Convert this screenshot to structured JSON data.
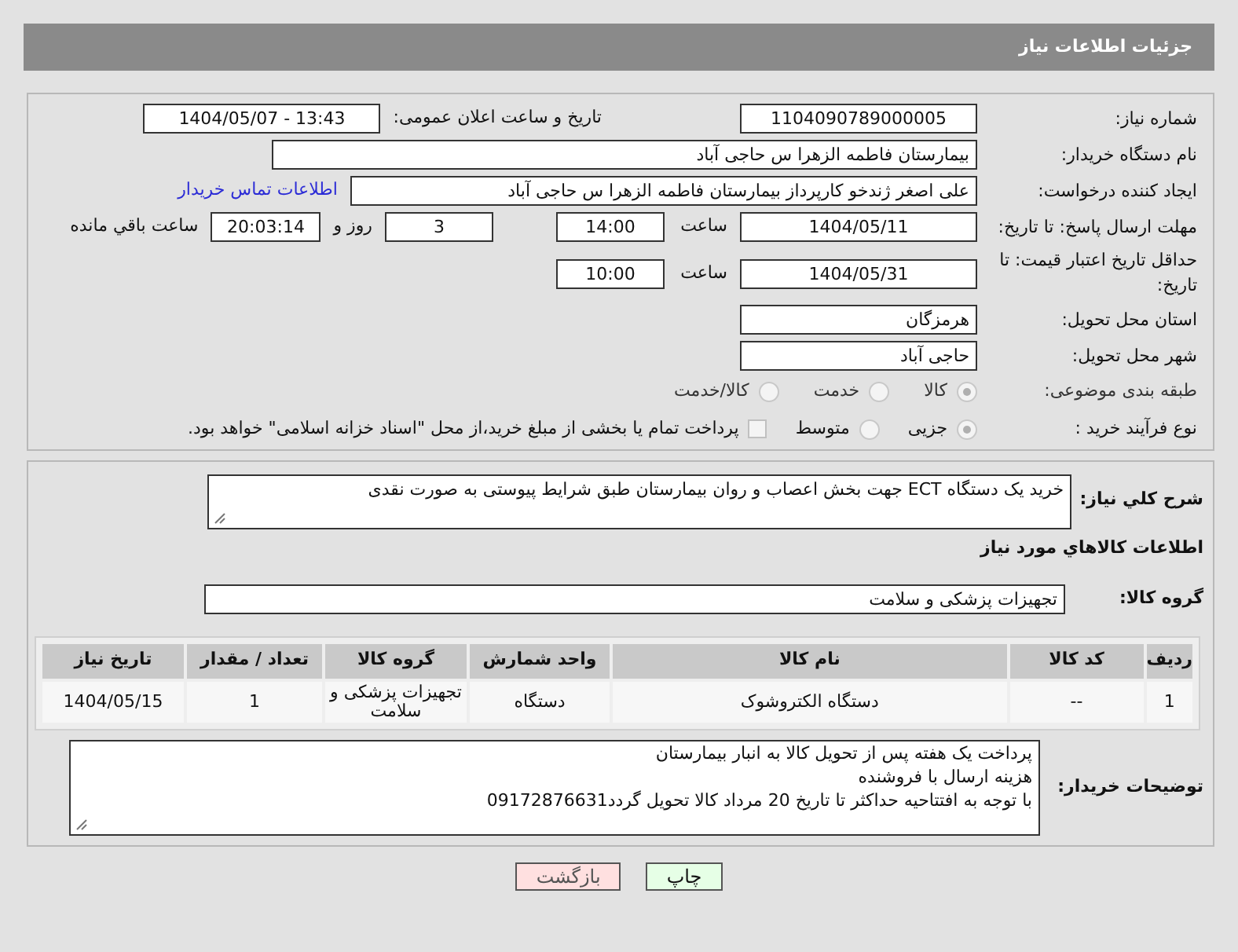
{
  "header": {
    "title": "جزئیات اطلاعات نیاز"
  },
  "need_number": {
    "label": "شماره نیاز:",
    "value": "1104090789000005"
  },
  "announce": {
    "label": "تاریخ و ساعت اعلان عمومی:",
    "value": "1404/05/07 - 13:43"
  },
  "buyer_org": {
    "label": "نام دستگاه خریدار:",
    "value": "بیمارستان فاطمه الزهرا  س  حاجی آباد"
  },
  "creator": {
    "label": "ایجاد کننده درخواست:",
    "value": "علی اصغر ژندخو کارپرداز بیمارستان فاطمه الزهرا  س  حاجی آباد",
    "link": "اطلاعات تماس خریدار"
  },
  "deadline": {
    "label": "مهلت ارسال پاسخ: تا تاریخ:",
    "date": "1404/05/11",
    "time_label": "ساعت",
    "time": "14:00",
    "days": "3",
    "days_label": "روز و",
    "remaining": "20:03:14",
    "remaining_label": "ساعت باقي مانده"
  },
  "validity": {
    "label": "حداقل تاریخ اعتبار قیمت: تا تاریخ:",
    "date": "1404/05/31",
    "time_label": "ساعت",
    "time": "10:00"
  },
  "province": {
    "label": "استان محل تحویل:",
    "value": "هرمزگان"
  },
  "city": {
    "label": "شهر محل تحویل:",
    "value": "حاجی آباد"
  },
  "category": {
    "label": "طبقه بندی موضوعی:",
    "options": [
      {
        "label": "کالا",
        "selected": true
      },
      {
        "label": "خدمت",
        "selected": false
      },
      {
        "label": "کالا/خدمت",
        "selected": false
      }
    ]
  },
  "process": {
    "label": "نوع فرآیند خرید :",
    "options": [
      {
        "label": "جزیی",
        "selected": true
      },
      {
        "label": "متوسط",
        "selected": false
      }
    ],
    "treasury": {
      "label": "پرداخت تمام یا بخشی از مبلغ خرید،از محل \"اسناد خزانه اسلامی\" خواهد بود.",
      "checked": false
    }
  },
  "description": {
    "label": "شرح کلي نياز:",
    "value": "خرید یک دستگاه ECT جهت بخش اعصاب و روان بیمارستان  طبق شرایط پیوستی به صورت نقدی"
  },
  "goods_title": "اطلاعات کالاهاي مورد نياز",
  "goods_group": {
    "label": "گروه کالا:",
    "value": "تجهیزات پزشکی و سلامت"
  },
  "table": {
    "columns": [
      "ردیف",
      "کد کالا",
      "نام کالا",
      "واحد شمارش",
      "گروه کالا",
      "تعداد / مقدار",
      "تاریخ نیاز"
    ],
    "rows": [
      [
        "1",
        "--",
        "دستگاه الکتروشوک",
        "دستگاه",
        "تجهیزات پزشکی و سلامت",
        "1",
        "1404/05/15"
      ]
    ]
  },
  "buyer_notes": {
    "label": "توضیحات خریدار:",
    "lines": [
      "پرداخت یک هفته پس از تحویل کالا به انبار بیمارستان",
      "هزینه ارسال با فروشنده",
      "با توجه به افتتاحیه حداکثر تا تاریخ 20 مرداد کالا تحویل گردد09172876631"
    ]
  },
  "buttons": [
    {
      "label": "چاپ",
      "kind": "print"
    },
    {
      "label": "بازگشت",
      "kind": "back"
    }
  ]
}
